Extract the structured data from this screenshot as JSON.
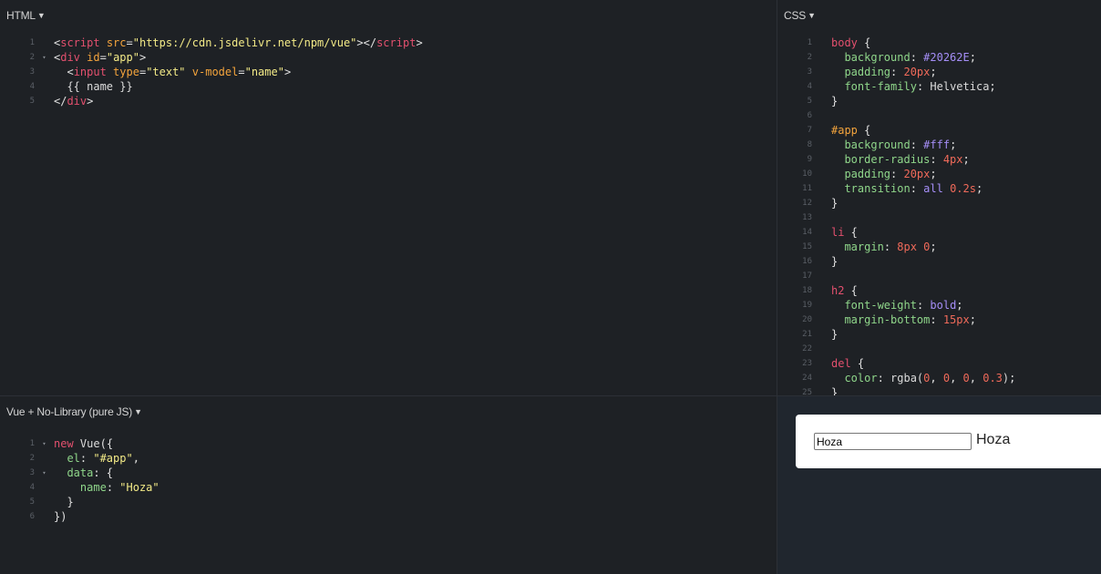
{
  "panes": {
    "html": {
      "title": "HTML"
    },
    "css": {
      "title": "CSS"
    },
    "js": {
      "title": "Vue + No-Library (pure JS)"
    }
  },
  "html_code": [
    {
      "n": "1",
      "fold": "",
      "tokens": [
        [
          "t-pun",
          "<"
        ],
        [
          "t-tag",
          "script"
        ],
        [
          "t-pun",
          " "
        ],
        [
          "t-attr",
          "src"
        ],
        [
          "t-pun",
          "="
        ],
        [
          "t-str",
          "\"https://cdn.jsdelivr.net/npm/vue\""
        ],
        [
          "t-pun",
          "></"
        ],
        [
          "t-tag",
          "script"
        ],
        [
          "t-pun",
          ">"
        ]
      ]
    },
    {
      "n": "2",
      "fold": "▾",
      "tokens": [
        [
          "t-pun",
          "<"
        ],
        [
          "t-tag",
          "div"
        ],
        [
          "t-pun",
          " "
        ],
        [
          "t-attr",
          "id"
        ],
        [
          "t-pun",
          "="
        ],
        [
          "t-str",
          "\"app\""
        ],
        [
          "t-pun",
          ">"
        ]
      ]
    },
    {
      "n": "3",
      "fold": "",
      "tokens": [
        [
          "t-pun",
          "  <"
        ],
        [
          "t-tag",
          "input"
        ],
        [
          "t-pun",
          " "
        ],
        [
          "t-attr",
          "type"
        ],
        [
          "t-pun",
          "="
        ],
        [
          "t-str",
          "\"text\""
        ],
        [
          "t-pun",
          " "
        ],
        [
          "t-attr",
          "v-model"
        ],
        [
          "t-pun",
          "="
        ],
        [
          "t-str",
          "\"name\""
        ],
        [
          "t-pun",
          ">"
        ]
      ]
    },
    {
      "n": "4",
      "fold": "",
      "tokens": [
        [
          "t-val",
          "  {{ name }}"
        ]
      ]
    },
    {
      "n": "5",
      "fold": "",
      "tokens": [
        [
          "t-pun",
          "</"
        ],
        [
          "t-tag",
          "div"
        ],
        [
          "t-pun",
          ">"
        ]
      ]
    }
  ],
  "css_code": [
    {
      "n": "1",
      "fold": "",
      "tokens": [
        [
          "t-sel",
          "body"
        ],
        [
          "t-pun",
          " {"
        ]
      ]
    },
    {
      "n": "2",
      "fold": "",
      "tokens": [
        [
          "t-pun",
          "  "
        ],
        [
          "t-prop",
          "background"
        ],
        [
          "t-pun",
          ": "
        ],
        [
          "t-hex",
          "#20262E"
        ],
        [
          "t-pun",
          ";"
        ]
      ]
    },
    {
      "n": "3",
      "fold": "",
      "tokens": [
        [
          "t-pun",
          "  "
        ],
        [
          "t-prop",
          "padding"
        ],
        [
          "t-pun",
          ": "
        ],
        [
          "t-num",
          "20px"
        ],
        [
          "t-pun",
          ";"
        ]
      ]
    },
    {
      "n": "4",
      "fold": "",
      "tokens": [
        [
          "t-pun",
          "  "
        ],
        [
          "t-prop",
          "font-family"
        ],
        [
          "t-pun",
          ": "
        ],
        [
          "t-val",
          "Helvetica"
        ],
        [
          "t-pun",
          ";"
        ]
      ]
    },
    {
      "n": "5",
      "fold": "",
      "tokens": [
        [
          "t-pun",
          "}"
        ]
      ]
    },
    {
      "n": "6",
      "fold": "",
      "tokens": []
    },
    {
      "n": "7",
      "fold": "",
      "tokens": [
        [
          "t-id",
          "#app"
        ],
        [
          "t-pun",
          " {"
        ]
      ]
    },
    {
      "n": "8",
      "fold": "",
      "tokens": [
        [
          "t-pun",
          "  "
        ],
        [
          "t-prop",
          "background"
        ],
        [
          "t-pun",
          ": "
        ],
        [
          "t-hex",
          "#fff"
        ],
        [
          "t-pun",
          ";"
        ]
      ]
    },
    {
      "n": "9",
      "fold": "",
      "tokens": [
        [
          "t-pun",
          "  "
        ],
        [
          "t-prop",
          "border-radius"
        ],
        [
          "t-pun",
          ": "
        ],
        [
          "t-num",
          "4px"
        ],
        [
          "t-pun",
          ";"
        ]
      ]
    },
    {
      "n": "10",
      "fold": "",
      "tokens": [
        [
          "t-pun",
          "  "
        ],
        [
          "t-prop",
          "padding"
        ],
        [
          "t-pun",
          ": "
        ],
        [
          "t-num",
          "20px"
        ],
        [
          "t-pun",
          ";"
        ]
      ]
    },
    {
      "n": "11",
      "fold": "",
      "tokens": [
        [
          "t-pun",
          "  "
        ],
        [
          "t-prop",
          "transition"
        ],
        [
          "t-pun",
          ": "
        ],
        [
          "t-hex",
          "all"
        ],
        [
          "t-pun",
          " "
        ],
        [
          "t-num",
          "0.2s"
        ],
        [
          "t-pun",
          ";"
        ]
      ]
    },
    {
      "n": "12",
      "fold": "",
      "tokens": [
        [
          "t-pun",
          "}"
        ]
      ]
    },
    {
      "n": "13",
      "fold": "",
      "tokens": []
    },
    {
      "n": "14",
      "fold": "",
      "tokens": [
        [
          "t-sel",
          "li"
        ],
        [
          "t-pun",
          " {"
        ]
      ]
    },
    {
      "n": "15",
      "fold": "",
      "tokens": [
        [
          "t-pun",
          "  "
        ],
        [
          "t-prop",
          "margin"
        ],
        [
          "t-pun",
          ": "
        ],
        [
          "t-num",
          "8px 0"
        ],
        [
          "t-pun",
          ";"
        ]
      ]
    },
    {
      "n": "16",
      "fold": "",
      "tokens": [
        [
          "t-pun",
          "}"
        ]
      ]
    },
    {
      "n": "17",
      "fold": "",
      "tokens": []
    },
    {
      "n": "18",
      "fold": "",
      "tokens": [
        [
          "t-sel",
          "h2"
        ],
        [
          "t-pun",
          " {"
        ]
      ]
    },
    {
      "n": "19",
      "fold": "",
      "tokens": [
        [
          "t-pun",
          "  "
        ],
        [
          "t-prop",
          "font-weight"
        ],
        [
          "t-pun",
          ": "
        ],
        [
          "t-hex",
          "bold"
        ],
        [
          "t-pun",
          ";"
        ]
      ]
    },
    {
      "n": "20",
      "fold": "",
      "tokens": [
        [
          "t-pun",
          "  "
        ],
        [
          "t-prop",
          "margin-bottom"
        ],
        [
          "t-pun",
          ": "
        ],
        [
          "t-num",
          "15px"
        ],
        [
          "t-pun",
          ";"
        ]
      ]
    },
    {
      "n": "21",
      "fold": "",
      "tokens": [
        [
          "t-pun",
          "}"
        ]
      ]
    },
    {
      "n": "22",
      "fold": "",
      "tokens": []
    },
    {
      "n": "23",
      "fold": "",
      "tokens": [
        [
          "t-sel",
          "del"
        ],
        [
          "t-pun",
          " {"
        ]
      ]
    },
    {
      "n": "24",
      "fold": "",
      "tokens": [
        [
          "t-pun",
          "  "
        ],
        [
          "t-prop",
          "color"
        ],
        [
          "t-pun",
          ": "
        ],
        [
          "t-val",
          "rgba("
        ],
        [
          "t-num",
          "0"
        ],
        [
          "t-pun",
          ", "
        ],
        [
          "t-num",
          "0"
        ],
        [
          "t-pun",
          ", "
        ],
        [
          "t-num",
          "0"
        ],
        [
          "t-pun",
          ", "
        ],
        [
          "t-num",
          "0.3"
        ],
        [
          "t-val",
          ")"
        ],
        [
          "t-pun",
          ";"
        ]
      ]
    },
    {
      "n": "25",
      "fold": "",
      "tokens": [
        [
          "t-pun",
          "}"
        ]
      ]
    }
  ],
  "js_code": [
    {
      "n": "1",
      "fold": "▾",
      "tokens": [
        [
          "t-kw",
          "new"
        ],
        [
          "t-pun",
          " "
        ],
        [
          "t-ident",
          "Vue"
        ],
        [
          "t-pun",
          "({"
        ]
      ]
    },
    {
      "n": "2",
      "fold": "",
      "tokens": [
        [
          "t-pun",
          "  "
        ],
        [
          "t-key",
          "el"
        ],
        [
          "t-pun",
          ": "
        ],
        [
          "t-str",
          "\"#app\""
        ],
        [
          "t-pun",
          ","
        ]
      ]
    },
    {
      "n": "3",
      "fold": "▾",
      "tokens": [
        [
          "t-pun",
          "  "
        ],
        [
          "t-key",
          "data"
        ],
        [
          "t-pun",
          ": {"
        ]
      ]
    },
    {
      "n": "4",
      "fold": "",
      "tokens": [
        [
          "t-pun",
          "    "
        ],
        [
          "t-key",
          "name"
        ],
        [
          "t-pun",
          ": "
        ],
        [
          "t-str",
          "\"Hoza\""
        ]
      ]
    },
    {
      "n": "5",
      "fold": "",
      "tokens": [
        [
          "t-pun",
          "  }"
        ]
      ]
    },
    {
      "n": "6",
      "fold": "",
      "tokens": [
        [
          "t-pun",
          "})"
        ]
      ]
    }
  ],
  "result": {
    "input_value": "Hoza",
    "output_text": "Hoza"
  }
}
